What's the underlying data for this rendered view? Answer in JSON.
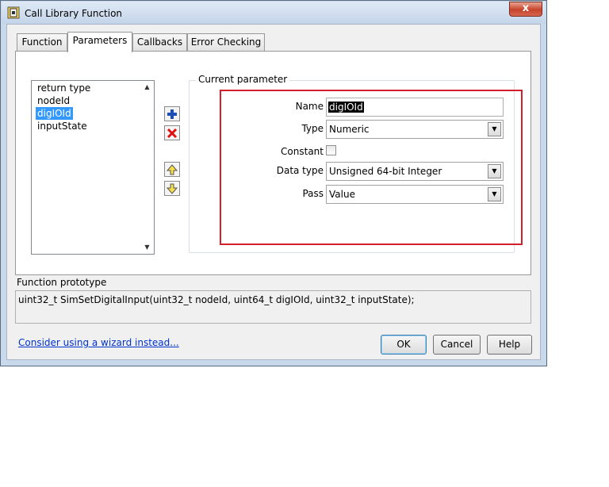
{
  "window": {
    "title": "Call Library Function",
    "close_glyph": "x"
  },
  "tabs": [
    {
      "label": "Function"
    },
    {
      "label": "Parameters"
    },
    {
      "label": "Callbacks"
    },
    {
      "label": "Error Checking"
    }
  ],
  "params": {
    "items": [
      "return type",
      "nodeId",
      "digIOId",
      "inputState"
    ],
    "selected_index": 2
  },
  "group": {
    "label": "Current parameter"
  },
  "fields": {
    "name_label": "Name",
    "name_value": "digIOId",
    "type_label": "Type",
    "type_value": "Numeric",
    "constant_label": "Constant",
    "datatype_label": "Data type",
    "datatype_value": "Unsigned 64-bit Integer",
    "pass_label": "Pass",
    "pass_value": "Value"
  },
  "prototype": {
    "label": "Function prototype",
    "text": "uint32_t SimSetDigitalInput(uint32_t nodeId, uint64_t digIOId, uint32_t inputState);"
  },
  "footer": {
    "wizard_link": "Consider using a wizard instead...",
    "ok_label": "OK",
    "cancel_label": "Cancel",
    "help_label": "Help"
  },
  "icons": {
    "add": "plus-icon",
    "remove": "delete-x-icon",
    "move_up": "arrow-up-icon",
    "move_down": "arrow-down-icon"
  },
  "colors": {
    "highlight": "#d3202a",
    "selection": "#3399ff",
    "link": "#0033cc"
  }
}
